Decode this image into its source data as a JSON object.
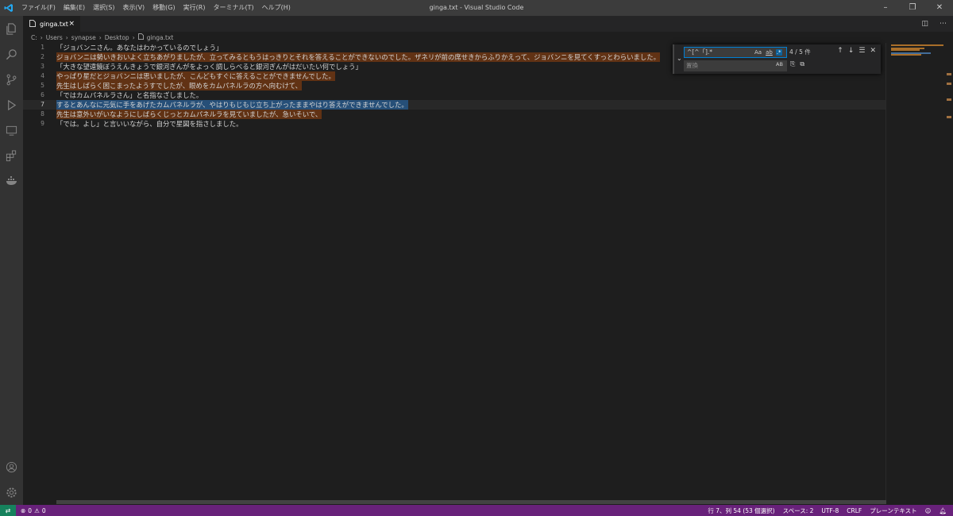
{
  "titlebar": {
    "menus": [
      "ファイル(F)",
      "編集(E)",
      "選択(S)",
      "表示(V)",
      "移動(G)",
      "実行(R)",
      "ターミナル(T)",
      "ヘルプ(H)"
    ],
    "window_title": "ginga.txt - Visual Studio Code",
    "controls": [
      "minimize-icon",
      "restore-icon",
      "close-icon"
    ]
  },
  "activitybar": {
    "top": [
      "explorer-icon",
      "search-icon",
      "source-control-icon",
      "run-debug-icon",
      "remote-explorer-icon",
      "extensions-icon",
      "docker-icon"
    ],
    "bottom": [
      "account-icon",
      "settings-gear-icon"
    ]
  },
  "tab": {
    "label": "ginga.txt",
    "close": "×"
  },
  "breadcrumb": [
    "C:",
    "Users",
    "synapse",
    "Desktop",
    "ginga.txt"
  ],
  "editor": {
    "current_line": 7,
    "lines": [
      {
        "num": "1",
        "text": "「ジョバンニさん。あなたはわかっているのでしょう」",
        "match": false
      },
      {
        "num": "2",
        "text": "ジョバンニは勢いきおいよく立ちあがりましたが、立ってみるともうはっきりとそれを答えることができないのでした。ザネリが前の席せきからふりかえって、ジョバンニを見てくすっとわらいました。",
        "match": true
      },
      {
        "num": "3",
        "text": "「大きな望遠鏡ぼうえんきょうで銀河ぎんがをよっく調しらべると銀河ぎんがはだいたい何でしょう」",
        "match": false
      },
      {
        "num": "4",
        "text": "やっぱり星だとジョバンニは思いましたが、こんどもすぐに答えることができませんでした。",
        "match": true
      },
      {
        "num": "5",
        "text": "先生はしばらく困こまったようすでしたが、眼めをカムパネルラの方へ向むけて、",
        "match": true
      },
      {
        "num": "6",
        "text": "「ではカムパネルラさん」と名指なざしました。",
        "match": false
      },
      {
        "num": "7",
        "text": "するとあんなに元気に手をあげたカムパネルラが、やはりもじもじ立ち上がったままやはり答えができませんでした。",
        "match": true,
        "active": true
      },
      {
        "num": "8",
        "text": "先生は意外いがいなようにしばらくじっとカムパネルラを見ていましたが、急いそいで、",
        "match": true
      },
      {
        "num": "9",
        "text": "「では。よし」と言いいながら、自分で星図を指さしました。",
        "match": false
      }
    ]
  },
  "find": {
    "query": "^[^「].*",
    "opts": [
      "Aa",
      "ab",
      ".*"
    ],
    "count": "4 / 5 件",
    "replace_placeholder": "置換",
    "preserve_case": "AB"
  },
  "statusbar": {
    "remote": "⇄",
    "errors": "0",
    "warnings": "0",
    "position": "行 7、列 54 (53 個選択)",
    "spaces": "スペース: 2",
    "encoding": "UTF-8",
    "eol": "CRLF",
    "language": "プレーンテキスト"
  }
}
